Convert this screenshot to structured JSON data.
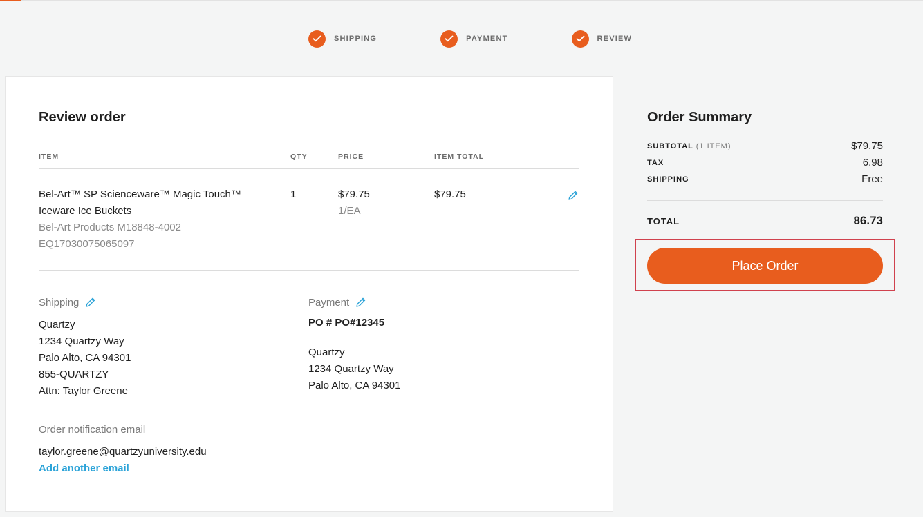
{
  "steps": [
    {
      "label": "SHIPPING"
    },
    {
      "label": "PAYMENT"
    },
    {
      "label": "REVIEW"
    }
  ],
  "review": {
    "title": "Review order",
    "columns": {
      "item": "ITEM",
      "qty": "QTY",
      "price": "PRICE",
      "item_total": "ITEM TOTAL"
    },
    "line_item": {
      "name_line1": "Bel-Art™ SP Scienceware™ Magic Touch™",
      "name_line2": "Iceware Ice Buckets",
      "vendor": "Bel-Art Products M18848-4002",
      "code": "EQ17030075065097",
      "qty": "1",
      "price": "$79.75",
      "unit": "1/EA",
      "item_total": "$79.75"
    }
  },
  "shipping": {
    "label": "Shipping",
    "lines": [
      "Quartzy",
      "1234 Quartzy Way",
      "Palo Alto, CA 94301",
      "855-QUARTZY",
      "Attn: Taylor Greene"
    ]
  },
  "payment": {
    "label": "Payment",
    "po": "PO # PO#12345",
    "lines": [
      "Quartzy",
      "1234 Quartzy Way",
      "Palo Alto, CA 94301"
    ]
  },
  "notification": {
    "label": "Order notification email",
    "email": "taylor.greene@quartzyuniversity.edu",
    "add_link": "Add another email"
  },
  "summary": {
    "title": "Order Summary",
    "subtotal_label": "SUBTOTAL",
    "subtotal_sub": "(1 ITEM)",
    "subtotal_value": "$79.75",
    "tax_label": "TAX",
    "tax_value": "6.98",
    "shipping_label": "SHIPPING",
    "shipping_value": "Free",
    "total_label": "TOTAL",
    "total_value": "86.73",
    "place_order": "Place Order"
  },
  "colors": {
    "accent": "#e85d1e",
    "link": "#2ba3d8",
    "highlight": "#d0424e"
  }
}
